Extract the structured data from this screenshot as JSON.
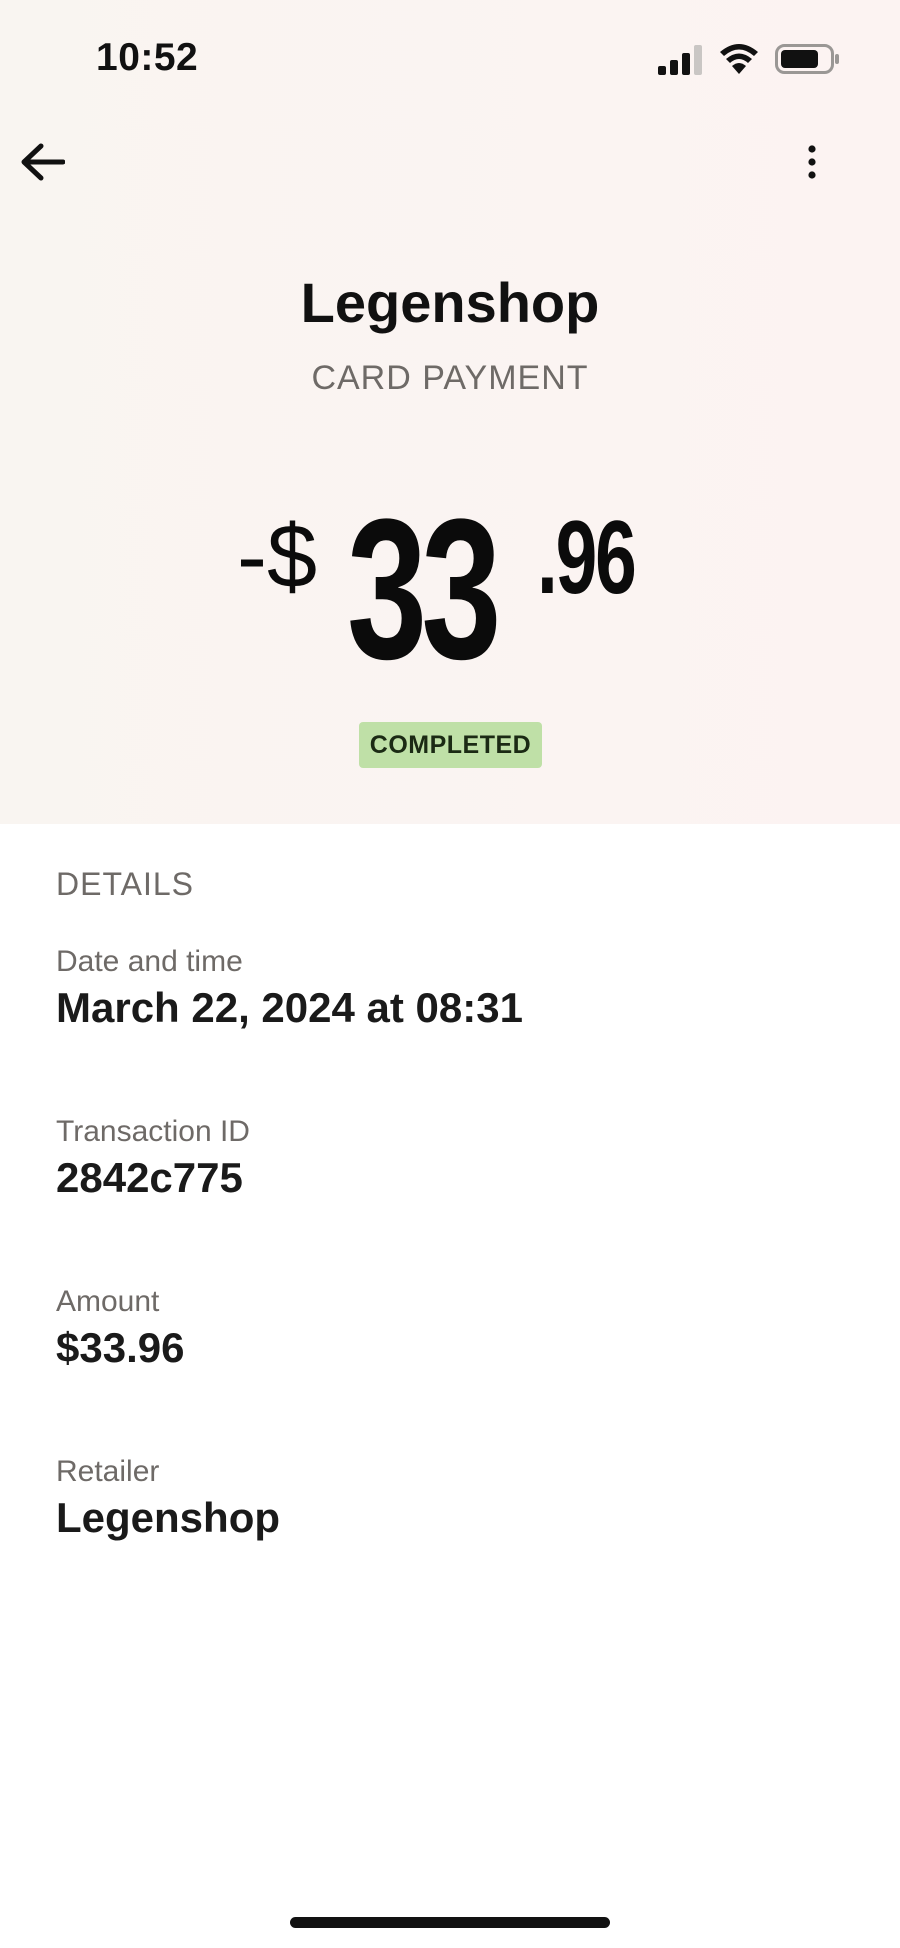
{
  "status_bar": {
    "time": "10:52"
  },
  "nav": {
    "back_icon": "arrow-left-icon",
    "more_icon": "more-vertical-icon"
  },
  "header": {
    "merchant": "Legenshop",
    "payment_type": "CARD PAYMENT",
    "amount_sign": "-$",
    "amount_integer": "33",
    "amount_decimal": ".96",
    "status": "COMPLETED",
    "status_color": "#bfe0a7"
  },
  "details": {
    "title": "DETAILS",
    "items": [
      {
        "label": "Date and time",
        "value": "March 22, 2024 at 08:31"
      },
      {
        "label": "Transaction ID",
        "value": "2842c775"
      },
      {
        "label": "Amount",
        "value": "$33.96"
      },
      {
        "label": "Retailer",
        "value": "Legenshop"
      }
    ]
  }
}
